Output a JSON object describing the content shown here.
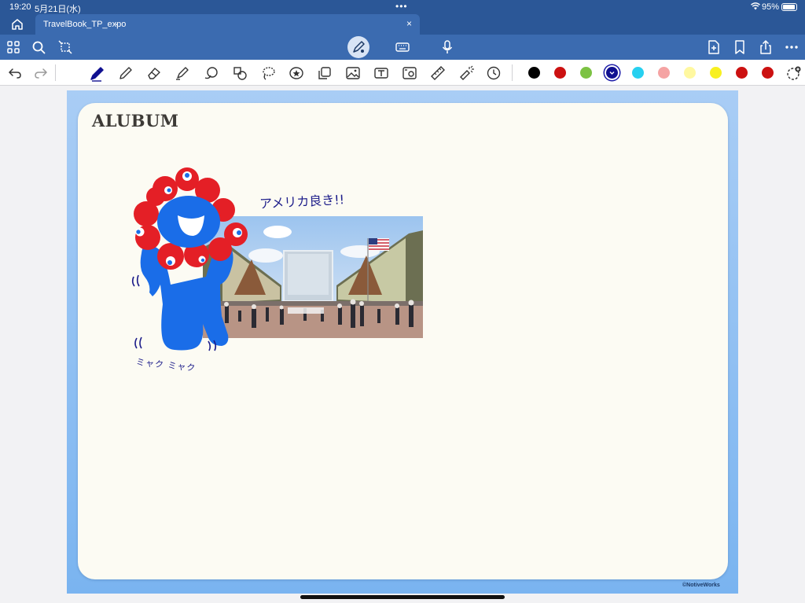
{
  "status_bar": {
    "time": "19:20",
    "date": "5月21日(水)",
    "multitask_dots": "•••",
    "battery": "95%"
  },
  "tab": {
    "title": "TravelBook_TP_expo",
    "chevron": "⌄",
    "close": "×"
  },
  "toolbar_icons": [
    "grid-icon",
    "search-icon",
    "lasso-add-icon",
    "pen-mode-icon",
    "keyboard-icon",
    "microphone-icon",
    "add-page-icon",
    "bookmark-icon",
    "share-icon",
    "more-icon"
  ],
  "drawing_tools": [
    "undo-icon",
    "redo-icon",
    "pen-icon",
    "pencil-icon",
    "eraser-icon",
    "highlighter-icon",
    "shape-icon",
    "element-icon",
    "lasso-icon",
    "sticker-icon",
    "copy-icon",
    "image-icon",
    "text-box-icon",
    "camera-icon",
    "ruler-icon",
    "laser-pointer-icon",
    "clock-icon"
  ],
  "colors": {
    "chrome": "#2b5797",
    "tab": "#3b6bb0",
    "swatches": [
      "#000000",
      "#cc1111",
      "#7cc243",
      "#101090",
      "#27d0f0",
      "#f5a3a3",
      "#fff8a0",
      "#f8f020",
      "#cc1111",
      "#cc1111"
    ],
    "selected_swatch_index": 3
  },
  "page": {
    "title": "ALUBUM",
    "handwriting_top": "アメリカ良き!!",
    "handwriting_bottom": "ミャク ミャク",
    "credit": "©NotiveWorks"
  }
}
